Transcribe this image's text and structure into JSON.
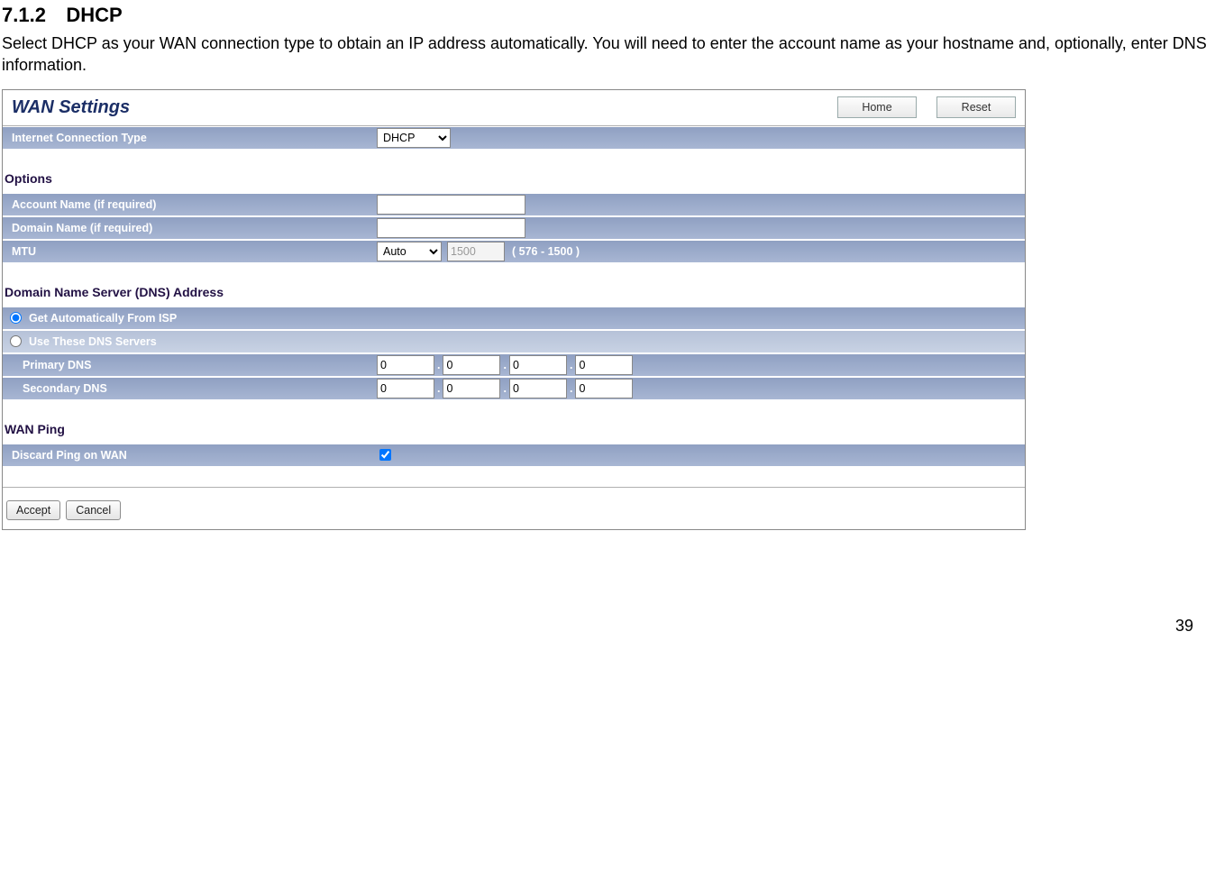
{
  "doc": {
    "section_number": "7.1.2",
    "section_title": "DHCP",
    "intro": "Select DHCP as your WAN connection type to obtain an IP address automatically. You will need to enter the account name as your hostname and, optionally, enter DNS information."
  },
  "wan": {
    "title": "WAN Settings",
    "buttons": {
      "home": "Home",
      "reset": "Reset"
    },
    "conn_type_label": "Internet Connection Type",
    "conn_type_value": "DHCP",
    "options_label": "Options",
    "account_name_label": "Account Name (if required)",
    "account_name_value": "",
    "domain_name_label": "Domain Name (if required)",
    "domain_name_value": "",
    "mtu_label": "MTU",
    "mtu_mode": "Auto",
    "mtu_value": "1500",
    "mtu_range": "( 576 - 1500 )",
    "dns_section_label": "Domain Name Server (DNS) Address",
    "dns_auto_label": "Get Automatically From ISP",
    "dns_use_label": "Use These DNS Servers",
    "primary_dns_label": "Primary DNS",
    "secondary_dns_label": "Secondary DNS",
    "dns_octets": {
      "p1": "0",
      "p2": "0",
      "p3": "0",
      "p4": "0",
      "s1": "0",
      "s2": "0",
      "s3": "0",
      "s4": "0"
    },
    "wan_ping_label": "WAN Ping",
    "discard_ping_label": "Discard Ping on WAN",
    "accept_btn": "Accept",
    "cancel_btn": "Cancel"
  },
  "page": {
    "number": "39"
  }
}
